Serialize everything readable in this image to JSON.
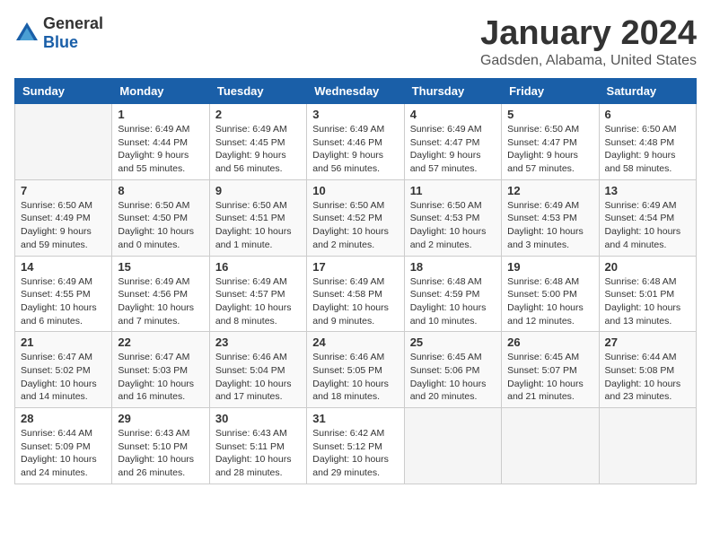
{
  "logo": {
    "general": "General",
    "blue": "Blue"
  },
  "header": {
    "month": "January 2024",
    "location": "Gadsden, Alabama, United States"
  },
  "weekdays": [
    "Sunday",
    "Monday",
    "Tuesday",
    "Wednesday",
    "Thursday",
    "Friday",
    "Saturday"
  ],
  "weeks": [
    [
      {
        "day": "",
        "info": ""
      },
      {
        "day": "1",
        "info": "Sunrise: 6:49 AM\nSunset: 4:44 PM\nDaylight: 9 hours\nand 55 minutes."
      },
      {
        "day": "2",
        "info": "Sunrise: 6:49 AM\nSunset: 4:45 PM\nDaylight: 9 hours\nand 56 minutes."
      },
      {
        "day": "3",
        "info": "Sunrise: 6:49 AM\nSunset: 4:46 PM\nDaylight: 9 hours\nand 56 minutes."
      },
      {
        "day": "4",
        "info": "Sunrise: 6:49 AM\nSunset: 4:47 PM\nDaylight: 9 hours\nand 57 minutes."
      },
      {
        "day": "5",
        "info": "Sunrise: 6:50 AM\nSunset: 4:47 PM\nDaylight: 9 hours\nand 57 minutes."
      },
      {
        "day": "6",
        "info": "Sunrise: 6:50 AM\nSunset: 4:48 PM\nDaylight: 9 hours\nand 58 minutes."
      }
    ],
    [
      {
        "day": "7",
        "info": "Sunrise: 6:50 AM\nSunset: 4:49 PM\nDaylight: 9 hours\nand 59 minutes."
      },
      {
        "day": "8",
        "info": "Sunrise: 6:50 AM\nSunset: 4:50 PM\nDaylight: 10 hours\nand 0 minutes."
      },
      {
        "day": "9",
        "info": "Sunrise: 6:50 AM\nSunset: 4:51 PM\nDaylight: 10 hours\nand 1 minute."
      },
      {
        "day": "10",
        "info": "Sunrise: 6:50 AM\nSunset: 4:52 PM\nDaylight: 10 hours\nand 2 minutes."
      },
      {
        "day": "11",
        "info": "Sunrise: 6:50 AM\nSunset: 4:53 PM\nDaylight: 10 hours\nand 2 minutes."
      },
      {
        "day": "12",
        "info": "Sunrise: 6:49 AM\nSunset: 4:53 PM\nDaylight: 10 hours\nand 3 minutes."
      },
      {
        "day": "13",
        "info": "Sunrise: 6:49 AM\nSunset: 4:54 PM\nDaylight: 10 hours\nand 4 minutes."
      }
    ],
    [
      {
        "day": "14",
        "info": "Sunrise: 6:49 AM\nSunset: 4:55 PM\nDaylight: 10 hours\nand 6 minutes."
      },
      {
        "day": "15",
        "info": "Sunrise: 6:49 AM\nSunset: 4:56 PM\nDaylight: 10 hours\nand 7 minutes."
      },
      {
        "day": "16",
        "info": "Sunrise: 6:49 AM\nSunset: 4:57 PM\nDaylight: 10 hours\nand 8 minutes."
      },
      {
        "day": "17",
        "info": "Sunrise: 6:49 AM\nSunset: 4:58 PM\nDaylight: 10 hours\nand 9 minutes."
      },
      {
        "day": "18",
        "info": "Sunrise: 6:48 AM\nSunset: 4:59 PM\nDaylight: 10 hours\nand 10 minutes."
      },
      {
        "day": "19",
        "info": "Sunrise: 6:48 AM\nSunset: 5:00 PM\nDaylight: 10 hours\nand 12 minutes."
      },
      {
        "day": "20",
        "info": "Sunrise: 6:48 AM\nSunset: 5:01 PM\nDaylight: 10 hours\nand 13 minutes."
      }
    ],
    [
      {
        "day": "21",
        "info": "Sunrise: 6:47 AM\nSunset: 5:02 PM\nDaylight: 10 hours\nand 14 minutes."
      },
      {
        "day": "22",
        "info": "Sunrise: 6:47 AM\nSunset: 5:03 PM\nDaylight: 10 hours\nand 16 minutes."
      },
      {
        "day": "23",
        "info": "Sunrise: 6:46 AM\nSunset: 5:04 PM\nDaylight: 10 hours\nand 17 minutes."
      },
      {
        "day": "24",
        "info": "Sunrise: 6:46 AM\nSunset: 5:05 PM\nDaylight: 10 hours\nand 18 minutes."
      },
      {
        "day": "25",
        "info": "Sunrise: 6:45 AM\nSunset: 5:06 PM\nDaylight: 10 hours\nand 20 minutes."
      },
      {
        "day": "26",
        "info": "Sunrise: 6:45 AM\nSunset: 5:07 PM\nDaylight: 10 hours\nand 21 minutes."
      },
      {
        "day": "27",
        "info": "Sunrise: 6:44 AM\nSunset: 5:08 PM\nDaylight: 10 hours\nand 23 minutes."
      }
    ],
    [
      {
        "day": "28",
        "info": "Sunrise: 6:44 AM\nSunset: 5:09 PM\nDaylight: 10 hours\nand 24 minutes."
      },
      {
        "day": "29",
        "info": "Sunrise: 6:43 AM\nSunset: 5:10 PM\nDaylight: 10 hours\nand 26 minutes."
      },
      {
        "day": "30",
        "info": "Sunrise: 6:43 AM\nSunset: 5:11 PM\nDaylight: 10 hours\nand 28 minutes."
      },
      {
        "day": "31",
        "info": "Sunrise: 6:42 AM\nSunset: 5:12 PM\nDaylight: 10 hours\nand 29 minutes."
      },
      {
        "day": "",
        "info": ""
      },
      {
        "day": "",
        "info": ""
      },
      {
        "day": "",
        "info": ""
      }
    ]
  ]
}
